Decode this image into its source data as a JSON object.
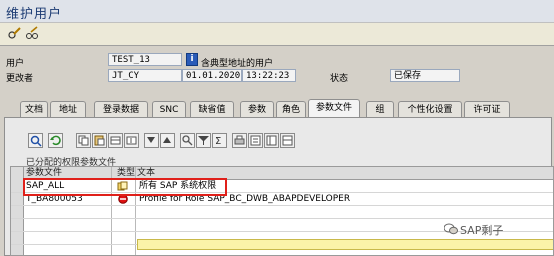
{
  "window": {
    "title": "维护用户"
  },
  "toolbar": {
    "icons": [
      "pencil-glasses-icon",
      "glasses-edit-icon"
    ]
  },
  "header": {
    "user_label": "用户",
    "user_value": "TEST_13",
    "user_desc": "含典型地址的用户",
    "changed_by_label": "更改者",
    "changed_by_value": "JT_CY",
    "date": "01.01.2020",
    "time": "13:22:23",
    "status_label": "状态",
    "status_value": "已保存"
  },
  "tabs": [
    {
      "label": "文档"
    },
    {
      "label": "地址"
    },
    {
      "label": "登录数据"
    },
    {
      "label": "SNC"
    },
    {
      "label": "缺省值"
    },
    {
      "label": "参数"
    },
    {
      "label": "角色"
    },
    {
      "label": "参数文件"
    },
    {
      "label": "组"
    },
    {
      "label": "个性化设置"
    },
    {
      "label": "许可证"
    }
  ],
  "profiles": {
    "grid_title": "已分配的权限参数文件",
    "columns": {
      "profile": "参数文件",
      "type": "类型",
      "text": "文本"
    },
    "rows": [
      {
        "profile": "SAP_ALL",
        "type_icon": "composite-profile-icon",
        "text": "所有 SAP 系统权限"
      },
      {
        "profile": "T_BA800053",
        "type_icon": "generated-profile-icon",
        "text": "Profile for Role SAP_BC_DWB_ABAPDEVELOPER"
      }
    ]
  },
  "watermark": {
    "text": "SAP剩子"
  },
  "colors": {
    "highlight": "#e0201a",
    "title": "#1c3b73",
    "input_yellow": "#fbf3a8"
  }
}
